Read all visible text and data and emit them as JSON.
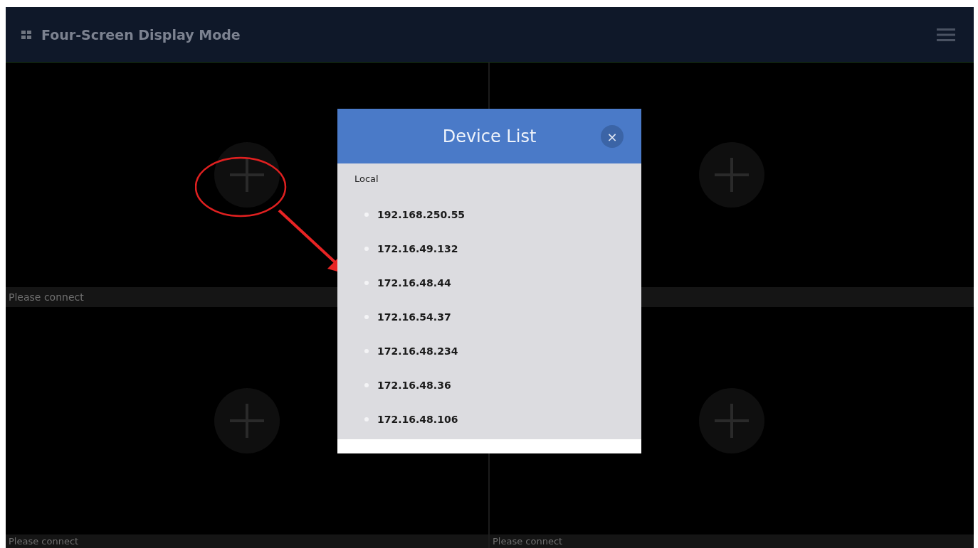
{
  "header": {
    "title": "Four-Screen Display Mode"
  },
  "screens": [
    {
      "kind": "labelled",
      "label": "Please connect"
    },
    {
      "kind": "blank"
    },
    {
      "kind": "labelled",
      "label": "Please connect"
    },
    {
      "kind": "labelled",
      "label": "Please connect"
    }
  ],
  "dialog": {
    "title": "Device List",
    "close": "×",
    "group": "Local",
    "devices": [
      {
        "address": "192.168.250.55"
      },
      {
        "address": "172.16.49.132"
      },
      {
        "address": "172.16.48.44"
      },
      {
        "address": "172.16.54.37"
      },
      {
        "address": "172.16.48.234"
      },
      {
        "address": "172.16.48.36"
      },
      {
        "address": "172.16.48.106"
      }
    ]
  }
}
